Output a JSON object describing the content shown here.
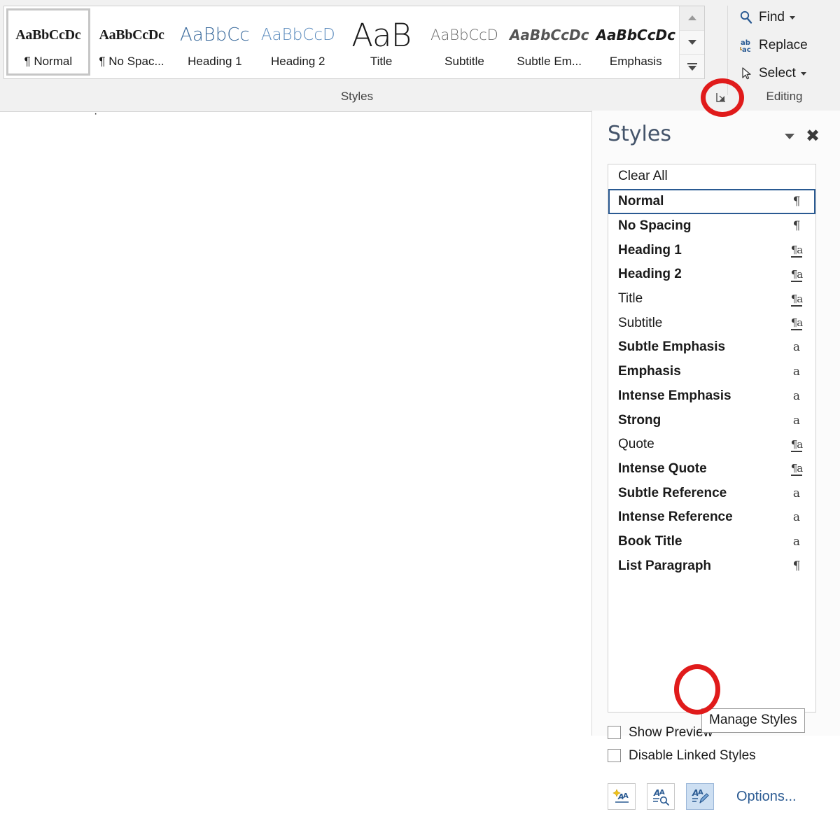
{
  "ribbon": {
    "styles_group": {
      "caption": "Styles",
      "dialog_launcher_name": "Styles dialog box launcher",
      "gallery_items": [
        {
          "preview": "AaBbCcDc",
          "label": "¶ Normal",
          "selected": true
        },
        {
          "preview": "AaBbCcDc",
          "label": "¶ No Spac...",
          "selected": false
        },
        {
          "preview": "AaBbCc",
          "label": "Heading 1",
          "selected": false
        },
        {
          "preview": "AaBbCcD",
          "label": "Heading 2",
          "selected": false
        },
        {
          "preview": "AaB",
          "label": "Title",
          "selected": false
        },
        {
          "preview": "AaBbCcD",
          "label": "Subtitle",
          "selected": false
        },
        {
          "preview": "AaBbCcDc",
          "label": "Subtle Em...",
          "selected": false
        },
        {
          "preview": "AaBbCcDc",
          "label": "Emphasis",
          "selected": false
        }
      ],
      "scroll_up": "scroll-up-arrow",
      "scroll_down": "scroll-down-arrow",
      "more_button": "more-styles-button"
    },
    "editing_group": {
      "caption": "Editing",
      "items": [
        {
          "label": "Find",
          "icon": "magnifier-icon",
          "has_dropdown": true
        },
        {
          "label": "Replace",
          "icon": "replace-abac-icon",
          "has_dropdown": false
        },
        {
          "label": "Select",
          "icon": "cursor-arrow-icon",
          "has_dropdown": true
        }
      ]
    }
  },
  "document": {
    "cursor_mark": "·"
  },
  "styles_pane": {
    "title": "Styles",
    "dropdown_icon": "chevron-down-icon",
    "close_icon": "close-icon",
    "clear_all": "Clear All",
    "styles": [
      {
        "name": "Normal",
        "mark": "¶",
        "mark_type": "pilcrow",
        "bold": true,
        "selected": true
      },
      {
        "name": "No Spacing",
        "mark": "¶",
        "mark_type": "pilcrow",
        "bold": true,
        "selected": false
      },
      {
        "name": "Heading 1",
        "mark": "¶a",
        "mark_type": "linked",
        "bold": true,
        "selected": false
      },
      {
        "name": "Heading 2",
        "mark": "¶a",
        "mark_type": "linked",
        "bold": true,
        "selected": false
      },
      {
        "name": "Title",
        "mark": "¶a",
        "mark_type": "linked",
        "bold": false,
        "selected": false
      },
      {
        "name": "Subtitle",
        "mark": "¶a",
        "mark_type": "linked",
        "bold": false,
        "selected": false
      },
      {
        "name": "Subtle Emphasis",
        "mark": "a",
        "mark_type": "char",
        "bold": true,
        "selected": false
      },
      {
        "name": "Emphasis",
        "mark": "a",
        "mark_type": "char",
        "bold": true,
        "selected": false
      },
      {
        "name": "Intense Emphasis",
        "mark": "a",
        "mark_type": "char",
        "bold": true,
        "selected": false
      },
      {
        "name": "Strong",
        "mark": "a",
        "mark_type": "char",
        "bold": true,
        "selected": false
      },
      {
        "name": "Quote",
        "mark": "¶a",
        "mark_type": "linked",
        "bold": false,
        "selected": false
      },
      {
        "name": "Intense Quote",
        "mark": "¶a",
        "mark_type": "linked",
        "bold": true,
        "selected": false
      },
      {
        "name": "Subtle Reference",
        "mark": "a",
        "mark_type": "char",
        "bold": true,
        "selected": false
      },
      {
        "name": "Intense Reference",
        "mark": "a",
        "mark_type": "char",
        "bold": true,
        "selected": false
      },
      {
        "name": "Book Title",
        "mark": "a",
        "mark_type": "char",
        "bold": true,
        "selected": false
      },
      {
        "name": "List Paragraph",
        "mark": "¶",
        "mark_type": "pilcrow",
        "bold": true,
        "selected": false
      }
    ],
    "checkboxes": [
      {
        "label": "Show Preview",
        "checked": false
      },
      {
        "label": "Disable Linked Styles",
        "checked": false
      }
    ],
    "buttons": [
      {
        "name": "new-style-button",
        "active": false
      },
      {
        "name": "style-inspector-button",
        "active": false
      },
      {
        "name": "manage-styles-button",
        "active": true
      }
    ],
    "options_link": "Options...",
    "tooltip": "Manage Styles"
  },
  "annotations": {
    "circle_color": "#e01b1b",
    "circles": [
      {
        "target": "styles-dialog-launcher"
      },
      {
        "target": "manage-styles-button"
      }
    ]
  }
}
